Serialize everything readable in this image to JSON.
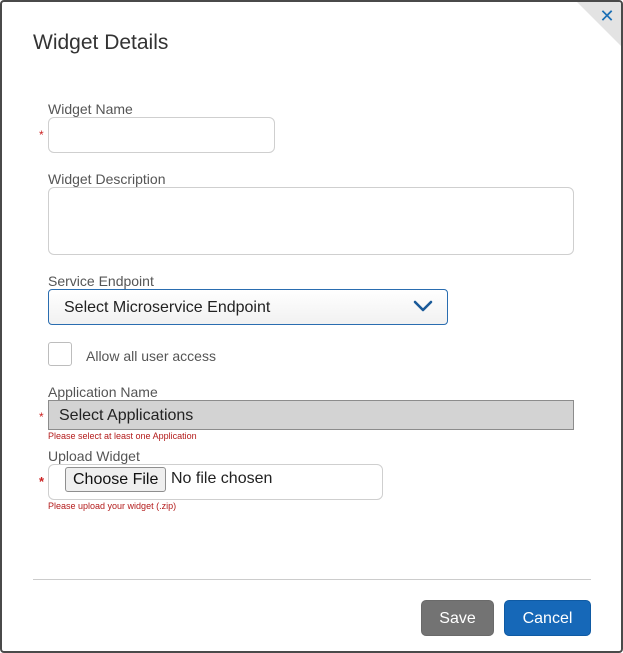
{
  "dialog": {
    "title": "Widget Details",
    "close_icon": "close-icon"
  },
  "fields": {
    "widget_name": {
      "label": "Widget Name",
      "required_mark": "*",
      "value": ""
    },
    "widget_description": {
      "label": "Widget Description",
      "value": ""
    },
    "service_endpoint": {
      "label": "Service Endpoint",
      "selected": "Select Microservice Endpoint",
      "icon": "chevron-down-icon"
    },
    "allow_all_access": {
      "label": "Allow all user access",
      "checked": false
    },
    "application_name": {
      "label": "Application Name",
      "required_mark": "*",
      "selected": "Select Applications",
      "error": "Please select at least one Application"
    },
    "upload_widget": {
      "label": "Upload Widget",
      "required_mark": "*",
      "button_label": "Choose File",
      "status": "No file chosen",
      "error": "Please upload your widget (.zip)"
    }
  },
  "footer": {
    "save_label": "Save",
    "cancel_label": "Cancel"
  },
  "colors": {
    "accent": "#1668b8",
    "error": "#b31b1b",
    "save_button": "#737373"
  }
}
